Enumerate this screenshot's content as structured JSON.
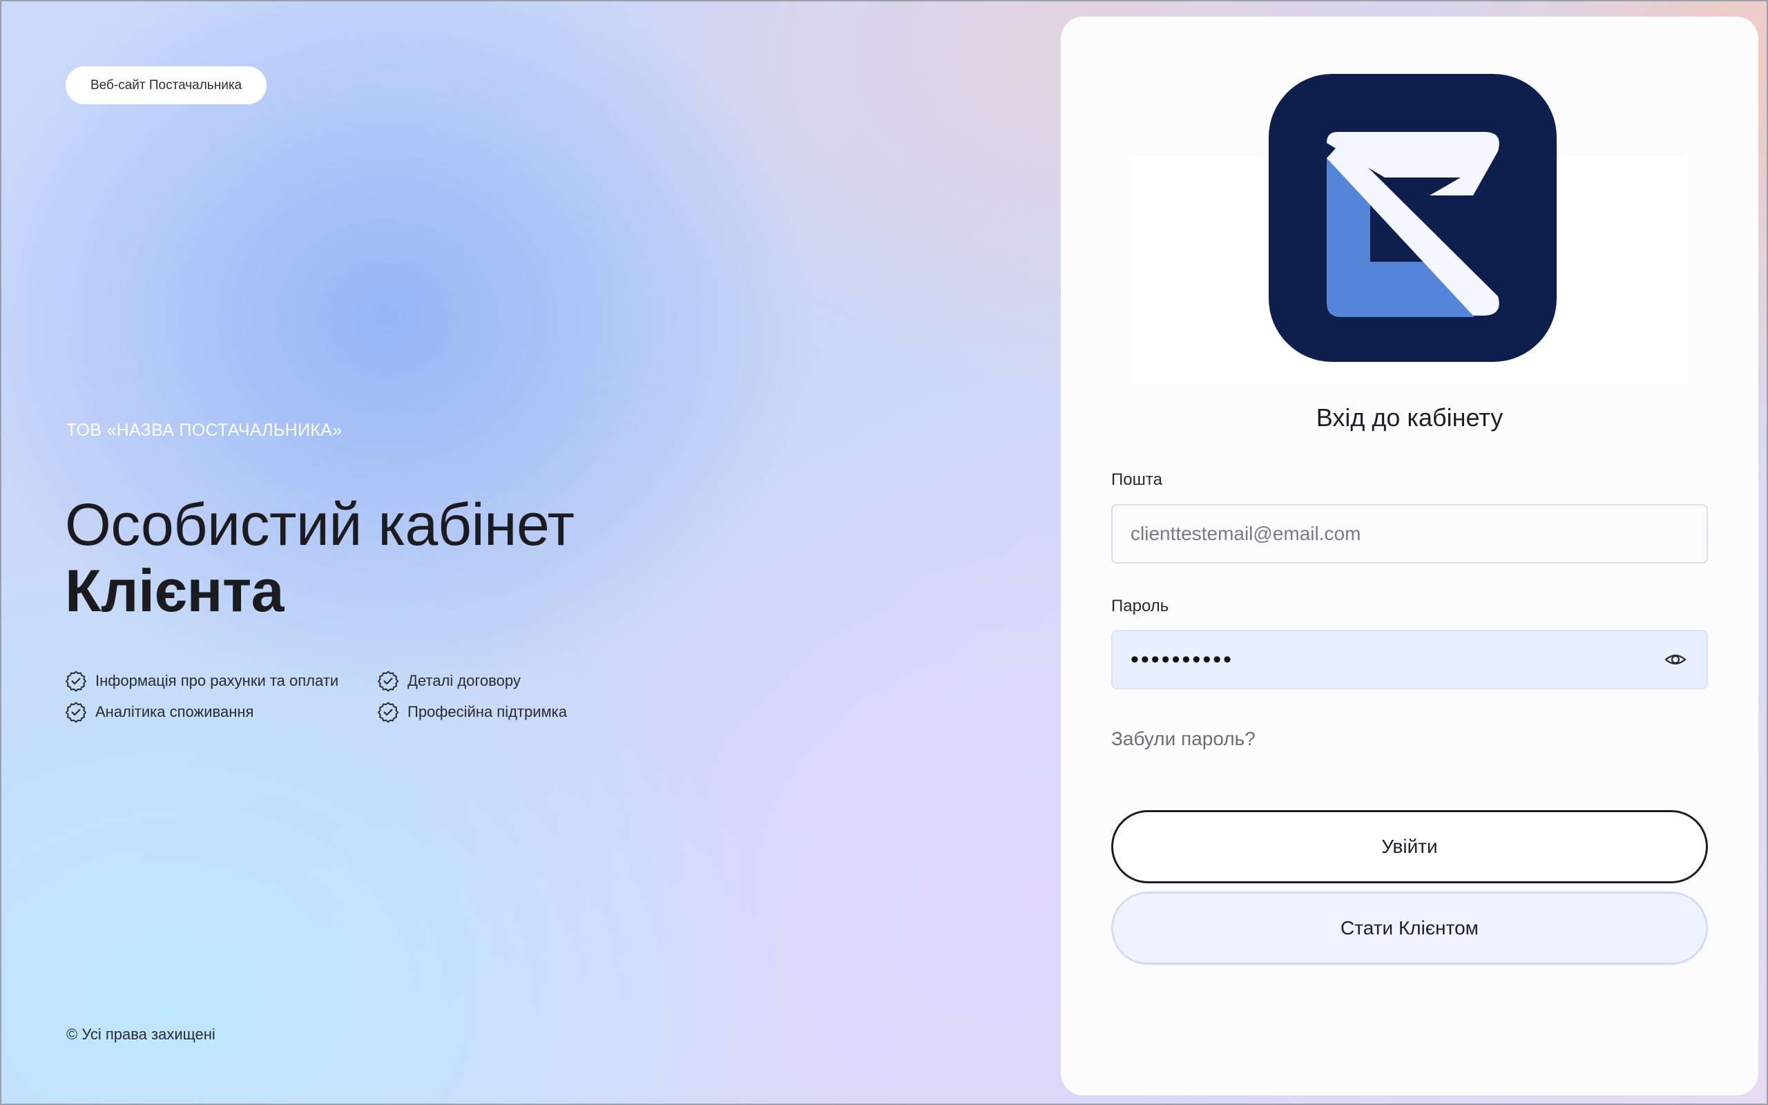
{
  "left": {
    "supplier_site_label": "Веб-сайт Постачальника",
    "company_name": "ТОВ «НАЗВА ПОСТАЧАЛЬНИКА»",
    "headline_line1": "Особистий кабінет",
    "headline_line2": "Клієнта",
    "features": [
      {
        "label": "Інформація про рахунки та оплати",
        "icon": "check-badge-icon"
      },
      {
        "label": "Деталі договору",
        "icon": "check-badge-icon"
      },
      {
        "label": "Аналітика споживання",
        "icon": "check-badge-icon"
      },
      {
        "label": "Професійна підтримка",
        "icon": "check-badge-icon"
      }
    ],
    "copyright": "© Усі права захищені"
  },
  "login": {
    "title": "Вхід до кабінету",
    "email_label": "Пошта",
    "email_placeholder": "clienttestemail@email.com",
    "email_value": "",
    "password_label": "Пароль",
    "password_value": "••••••••••",
    "password_toggle_icon": "eye-icon",
    "forgot_link": "Забули пароль?",
    "login_button": "Увійти",
    "register_button": "Стати Клієнтом"
  },
  "colors": {
    "logo_background": "#0e1f4d",
    "logo_accent": "#5585d8",
    "logo_foreground": "#f4f7ff",
    "password_field_bg": "#e8effd",
    "register_button_bg": "#eef3ff"
  }
}
